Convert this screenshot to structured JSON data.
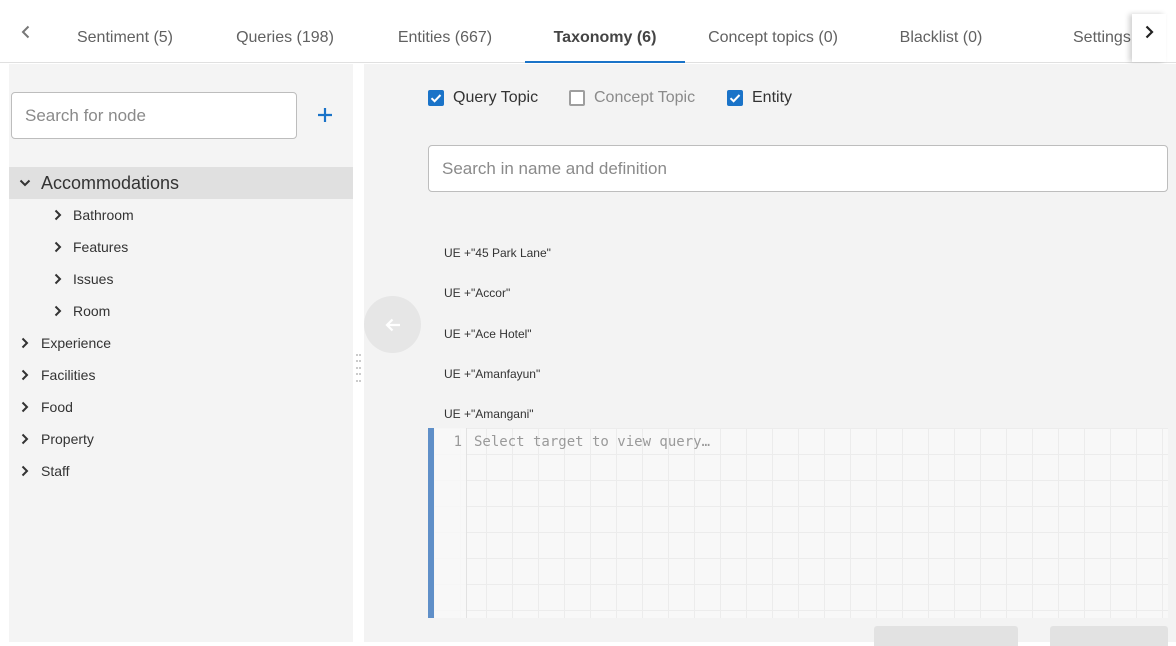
{
  "tabs": [
    {
      "label": "Sentiment (5)"
    },
    {
      "label": "Queries (198)"
    },
    {
      "label": "Entities (667)"
    },
    {
      "label": "Taxonomy (6)"
    },
    {
      "label": "Concept topics (0)"
    },
    {
      "label": "Blacklist (0)"
    },
    {
      "label": "Settings"
    }
  ],
  "active_tab": "Taxonomy (6)",
  "left": {
    "search_placeholder": "Search for node",
    "tree": {
      "root": {
        "label": "Accommodations",
        "expanded": true,
        "selected": true
      },
      "children": [
        {
          "label": "Bathroom"
        },
        {
          "label": "Features"
        },
        {
          "label": "Issues"
        },
        {
          "label": "Room"
        }
      ],
      "siblings": [
        {
          "label": "Experience"
        },
        {
          "label": "Facilities"
        },
        {
          "label": "Food"
        },
        {
          "label": "Property"
        },
        {
          "label": "Staff"
        }
      ]
    }
  },
  "right": {
    "filters": [
      {
        "label": "Query Topic",
        "checked": true
      },
      {
        "label": "Concept Topic",
        "checked": false
      },
      {
        "label": "Entity",
        "checked": true
      }
    ],
    "search_placeholder": "Search in name and definition",
    "queries": [
      {
        "text": "UE +\"45 Park Lane\""
      },
      {
        "text": "UE +\"Accor\""
      },
      {
        "text": "UE +\"Ace Hotel\""
      },
      {
        "text": "UE +\"Amanfayun\""
      },
      {
        "text": "UE +\"Amangani\""
      }
    ],
    "editor": {
      "line_number": "1",
      "placeholder": "Select target to view query…"
    }
  },
  "colors": {
    "accent": "#1a73c8",
    "editor_bar": "#5f8fc8"
  },
  "icons": {
    "prev": "chevron-left-icon",
    "next": "chevron-right-icon",
    "add": "plus-icon",
    "back": "arrow-left-icon",
    "expand": "chevron-down-icon",
    "collapse": "chevron-right-icon"
  }
}
